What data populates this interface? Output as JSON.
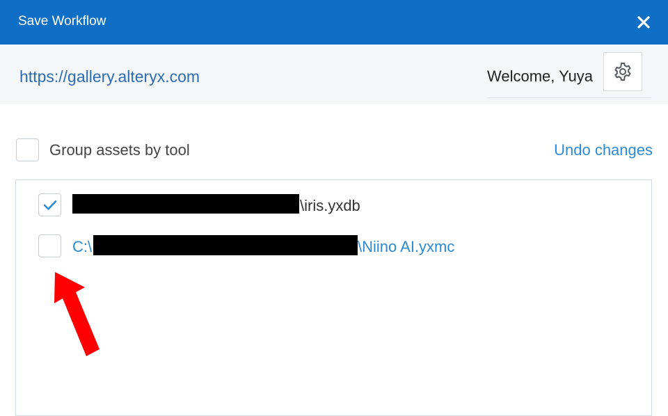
{
  "dialog": {
    "title": "Save Workflow",
    "close_icon": "close-icon"
  },
  "server": {
    "url": "https://gallery.alteryx.com",
    "welcome": "Welcome, Yuya",
    "settings_icon": "gear-icon"
  },
  "options": {
    "group_assets_label": "Group assets by tool",
    "group_assets_checked": false,
    "undo_label": "Undo changes"
  },
  "assets": [
    {
      "prefix": "",
      "suffix": "\\iris.yxdb",
      "checked": true
    },
    {
      "prefix": "C:\\",
      "suffix": "\\Niino AI.yxmc",
      "checked": false
    }
  ],
  "colors": {
    "titlebar": "#0f6fc6",
    "link": "#2b8ad6",
    "annotation_arrow": "#ff0000",
    "redaction": "#000000"
  },
  "annotation": {
    "arrow_icon": "red-arrow-icon"
  }
}
